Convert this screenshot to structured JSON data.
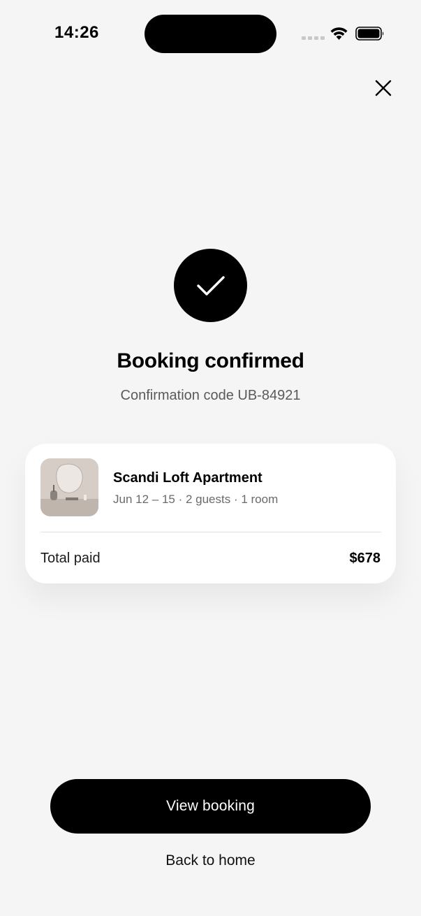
{
  "status_bar": {
    "time": "14:26",
    "wifi_icon": "wifi-icon",
    "battery_icon": "battery-icon"
  },
  "header": {
    "close_icon": "close-icon"
  },
  "confirmation": {
    "icon": "checkmark-icon",
    "title": "Booking confirmed",
    "code_text": "Confirmation code UB-84921"
  },
  "booking": {
    "property_name": "Scandi Loft Apartment",
    "details": "Jun 12 – 15 · 2 guests · 1 room",
    "total_label": "Total paid",
    "total_amount": "$678"
  },
  "actions": {
    "primary_label": "View booking",
    "secondary_label": "Back to home"
  },
  "colors": {
    "background": "#f5f5f5",
    "accent": "#000000",
    "card": "#ffffff",
    "muted_text": "#6a6a6a"
  }
}
